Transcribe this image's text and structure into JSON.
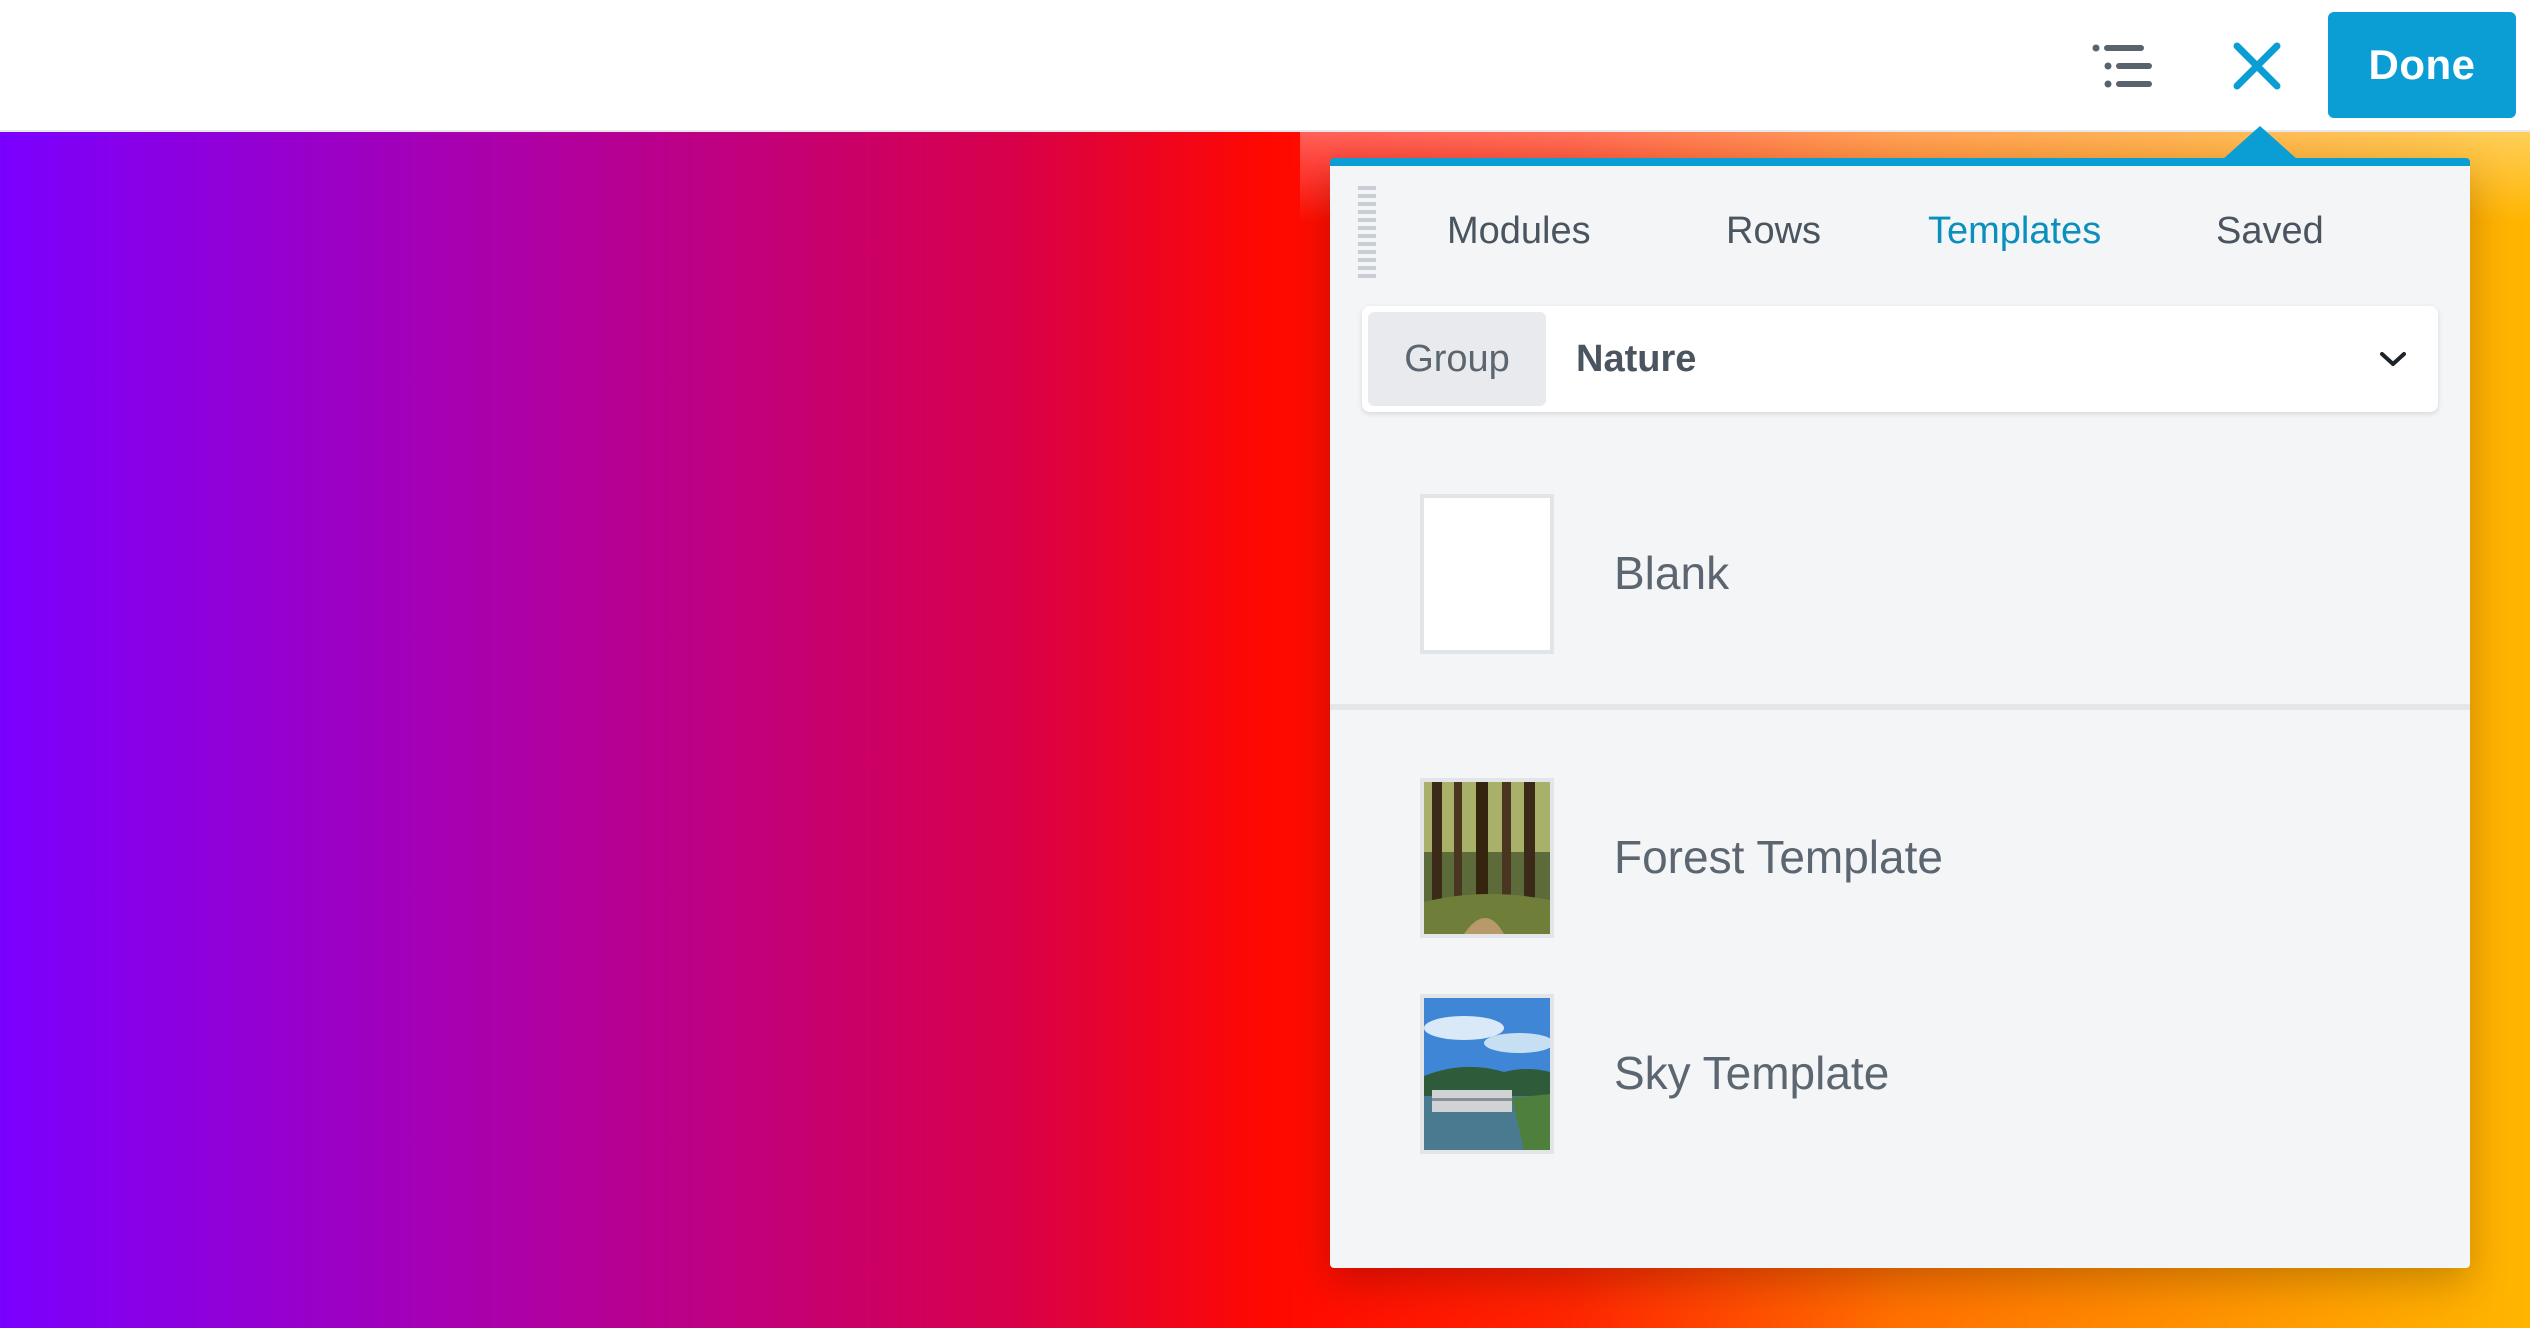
{
  "topbar": {
    "outline_icon": "outline-list-icon",
    "close_icon": "close-icon",
    "done_label": "Done",
    "accent_color": "#0b9ed4"
  },
  "panel": {
    "tabs": [
      {
        "label": "Modules",
        "active": false
      },
      {
        "label": "Rows",
        "active": false
      },
      {
        "label": "Templates",
        "active": true
      },
      {
        "label": "Saved",
        "active": false
      }
    ],
    "group_select": {
      "label": "Group",
      "value": "Nature",
      "icon": "chevron-down-icon"
    },
    "templates": [
      {
        "name": "Blank",
        "thumbnail": "blank"
      },
      {
        "name": "Forest Template",
        "thumbnail": "forest-photo"
      },
      {
        "name": "Sky Template",
        "thumbnail": "sky-photo"
      }
    ]
  }
}
